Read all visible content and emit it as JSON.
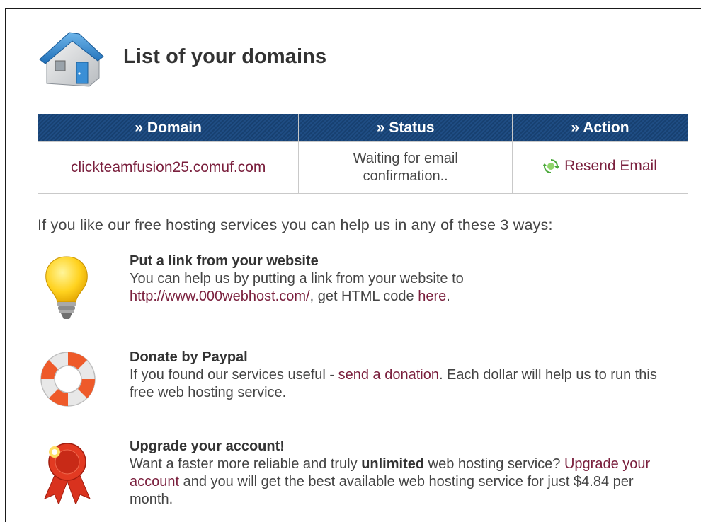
{
  "header": {
    "title": "List of your domains",
    "icon": "house-icon"
  },
  "table": {
    "columns": [
      "» Domain",
      "» Status",
      "» Action"
    ],
    "rows": [
      {
        "domain": "clickteamfusion25.comuf.com",
        "status_line1": "Waiting for email",
        "status_line2": "confirmation..",
        "action_label": "Resend Email",
        "action_icon": "refresh-icon"
      }
    ],
    "header_color": "#1f4d84",
    "link_color": "#7a1f3d"
  },
  "intro": "If you like our free hosting services you can help us in any of these 3 ways:",
  "ways": [
    {
      "icon": "lightbulb-icon",
      "title": "Put a link from your website",
      "text1": "You can help us by putting a link from your website to",
      "link1": "http://www.000webhost.com/",
      "text2": ", get HTML code ",
      "link2": "here",
      "text3": "."
    },
    {
      "icon": "lifebuoy-icon",
      "title": "Donate by Paypal",
      "text1": "If you found our services useful - ",
      "link1": "send a donation",
      "text2": ". Each dollar will help us to run this free web hosting service."
    },
    {
      "icon": "award-ribbon-icon",
      "title": "Upgrade your account!",
      "text1": "Want a faster more reliable and truly ",
      "bold1": "unlimited",
      "text2": " web hosting service? ",
      "link1": "Upgrade your account",
      "text3": " and you will get the best available web hosting service for just $4.84 per month."
    }
  ]
}
